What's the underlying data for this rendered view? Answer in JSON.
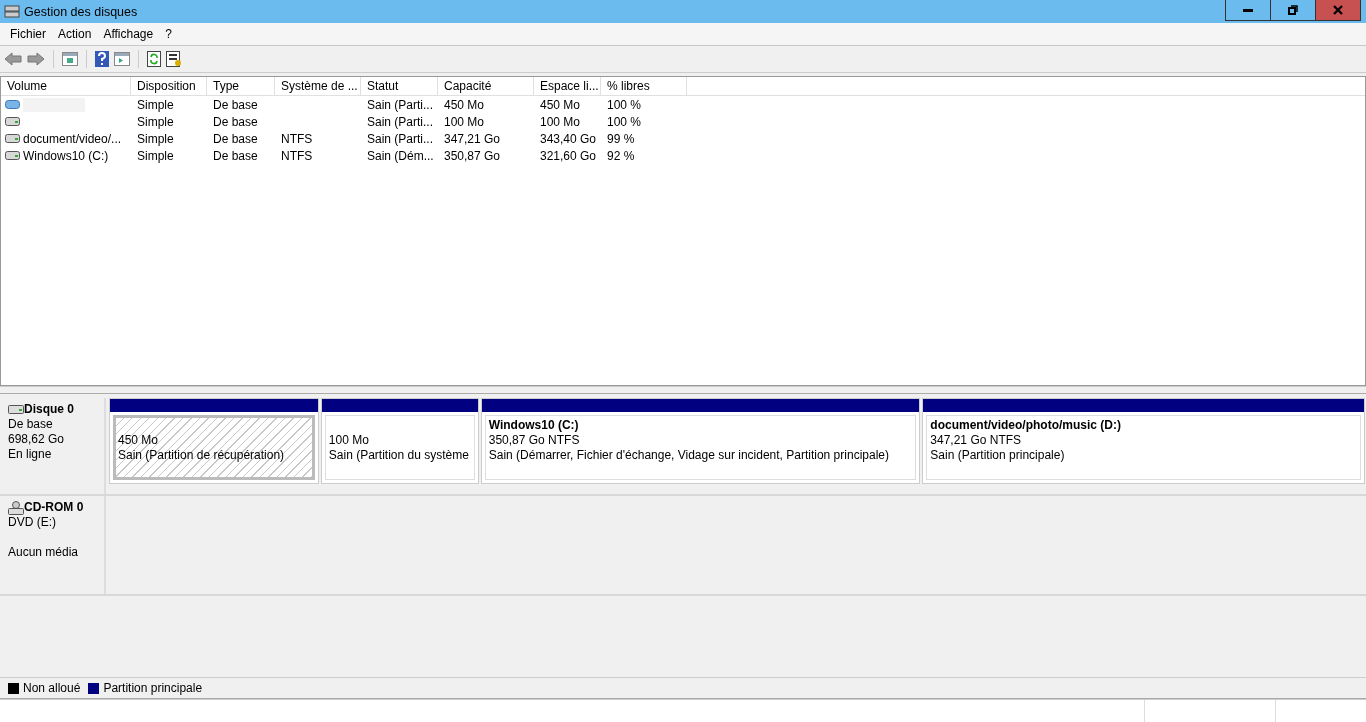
{
  "window": {
    "title": "Gestion des disques"
  },
  "menu": [
    "Fichier",
    "Action",
    "Affichage",
    "?"
  ],
  "table": {
    "columns": [
      "Volume",
      "Disposition",
      "Type",
      "Système de ...",
      "Statut",
      "Capacité",
      "Espace li...",
      "% libres"
    ],
    "rows": [
      {
        "kind": "hidden",
        "cells": [
          "",
          "Simple",
          "De base",
          "",
          "Sain (Parti...",
          "450 Mo",
          "450 Mo",
          "100 %"
        ]
      },
      {
        "kind": "drive",
        "cells": [
          "",
          "Simple",
          "De base",
          "",
          "Sain (Parti...",
          "100 Mo",
          "100 Mo",
          "100 %"
        ]
      },
      {
        "kind": "drive",
        "cells": [
          "document/video/...",
          "Simple",
          "De base",
          "NTFS",
          "Sain (Parti...",
          "347,21 Go",
          "343,40 Go",
          "99 %"
        ]
      },
      {
        "kind": "drive",
        "cells": [
          "Windows10 (C:)",
          "Simple",
          "De base",
          "NTFS",
          "Sain (Dém...",
          "350,87 Go",
          "321,60 Go",
          "92 %"
        ]
      }
    ]
  },
  "disks": [
    {
      "kind": "disk",
      "name": "Disque 0",
      "lines": [
        "De base",
        "698,62 Go",
        "En ligne"
      ],
      "partitions": [
        {
          "selected": true,
          "size": "450 Mo",
          "status": "Sain (Partition de récupération)"
        },
        {
          "selected": false,
          "size": "100 Mo",
          "status": "Sain (Partition du système"
        },
        {
          "selected": false,
          "title": "Windows10  (C:)",
          "size": "350,87 Go NTFS",
          "status": "Sain (Démarrer, Fichier d'échange, Vidage sur incident, Partition principale)"
        },
        {
          "selected": false,
          "title": "document/video/photo/music  (D:)",
          "size": "347,21 Go NTFS",
          "status": "Sain (Partition principale)"
        }
      ]
    },
    {
      "kind": "cdrom",
      "name": "CD-ROM 0",
      "lines": [
        "DVD (E:)"
      ],
      "media": "Aucun média"
    }
  ],
  "legend": [
    {
      "label": "Non alloué",
      "color": "#000000"
    },
    {
      "label": "Partition principale",
      "color": "#000080"
    }
  ]
}
